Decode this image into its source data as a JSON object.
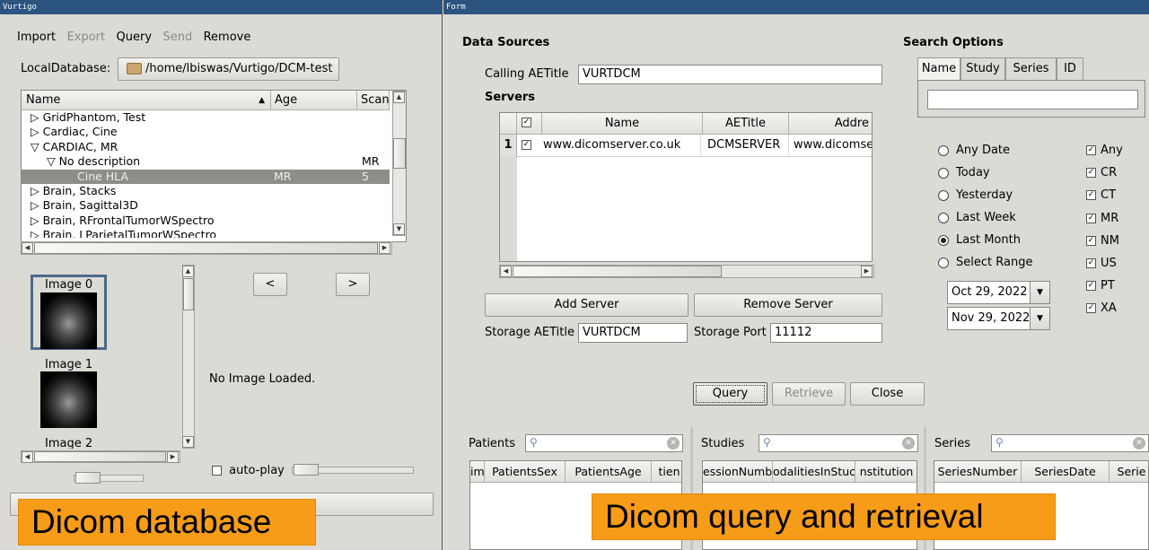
{
  "left": {
    "title": "Vurtigo",
    "menu": {
      "import": "Import",
      "export": "Export",
      "query": "Query",
      "send": "Send",
      "remove": "Remove"
    },
    "local_db_label": "LocalDatabase:",
    "local_db_path": "/home/lbiswas/Vurtigo/DCM-test",
    "tree_headers": {
      "name": "Name",
      "age": "Age",
      "scan": "Scan"
    },
    "tree_rows": [
      {
        "label": "▷ GridPhantom, Test",
        "age": "",
        "scan": ""
      },
      {
        "label": "▷ Cardiac, Cine",
        "age": "",
        "scan": ""
      },
      {
        "label": "▽ CARDIAC, MR",
        "age": "",
        "scan": ""
      },
      {
        "label": "▽ No description",
        "age": "",
        "scan": "MR"
      },
      {
        "label": "Cine HLA",
        "age": "MR",
        "scan": "5"
      },
      {
        "label": "▷ Brain, Stacks",
        "age": "",
        "scan": ""
      },
      {
        "label": "▷ Brain, Sagittal3D",
        "age": "",
        "scan": ""
      },
      {
        "label": "▷ Brain, RFrontalTumorWSpectro",
        "age": "",
        "scan": ""
      },
      {
        "label": "▷ Brain, LParietalTumorWSpectro",
        "age": "",
        "scan": ""
      }
    ],
    "images": [
      "Image 0",
      "Image 1",
      "Image 2"
    ],
    "prev_label": "<",
    "next_label": ">",
    "no_image": "No Image Loaded.",
    "autoplay_label": "auto-play",
    "overlay": "Dicom database"
  },
  "right": {
    "title": "Form",
    "data_sources_label": "Data Sources",
    "calling_ae_label": "Calling AETitle",
    "calling_ae_value": "VURTDCM",
    "servers_label": "Servers",
    "server_headers": {
      "name": "Name",
      "aetitle": "AETitle",
      "address": "Addre"
    },
    "servers": [
      {
        "index": "1",
        "name": "www.dicomserver.co.uk",
        "aetitle": "DCMSERVER",
        "address": "www.dicomser"
      }
    ],
    "add_server": "Add Server",
    "remove_server": "Remove Server",
    "storage_ae_label": "Storage AETitle",
    "storage_ae_value": "VURTDCM",
    "storage_port_label": "Storage Port",
    "storage_port_value": "11112",
    "search_options_label": "Search Options",
    "search_tabs": [
      "Name",
      "Study",
      "Series",
      "ID"
    ],
    "date_options": [
      "Any Date",
      "Today",
      "Yesterday",
      "Last Week",
      "Last Month",
      "Select Range"
    ],
    "selected_date": "Last Month",
    "from_date": "Oct 29, 2022",
    "to_date": "Nov 29, 2022",
    "modalities": [
      "Any",
      "CR",
      "CT",
      "MR",
      "NM",
      "US",
      "PT",
      "XA"
    ],
    "query_btn": "Query",
    "retrieve_btn": "Retrieve",
    "close_btn": "Close",
    "patients_label": "Patients",
    "patients_cols": [
      "im",
      "PatientsSex",
      "PatientsAge",
      "tien"
    ],
    "studies_label": "Studies",
    "studies_cols": [
      "essionNumb",
      "odalitiesInStuc",
      "nstitution"
    ],
    "series_label": "Series",
    "series_cols": [
      "SeriesNumber",
      "SeriesDate",
      "Serie"
    ],
    "overlay": "Dicom query and retrieval"
  }
}
